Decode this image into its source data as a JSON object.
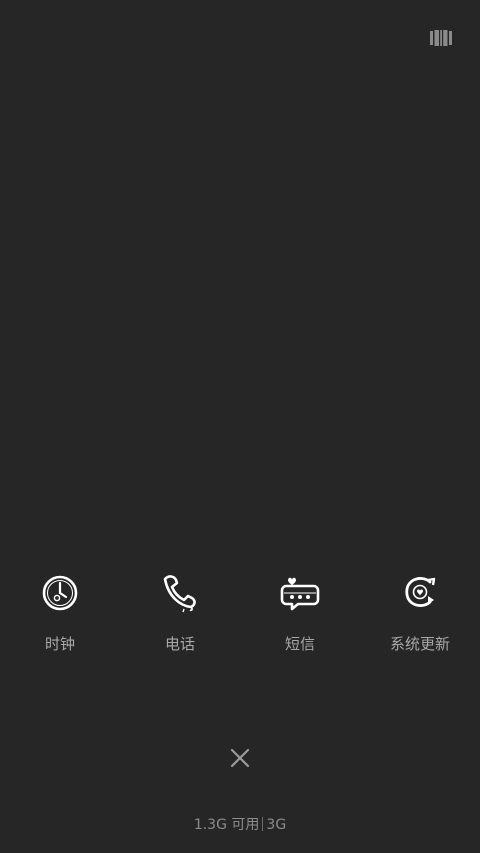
{
  "top_button": {
    "icon": "multi-window-icon"
  },
  "apps": [
    {
      "label": "时钟",
      "icon": "clock-icon"
    },
    {
      "label": "电话",
      "icon": "phone-icon"
    },
    {
      "label": "短信",
      "icon": "message-icon"
    },
    {
      "label": "系统更新",
      "icon": "system-update-icon"
    }
  ],
  "close": {
    "icon": "close-icon"
  },
  "memory": {
    "available": "1.3G 可用",
    "total": "3G"
  },
  "colors": {
    "background": "#262626",
    "label": "#a8a8a8",
    "icon": "#ffffff"
  }
}
